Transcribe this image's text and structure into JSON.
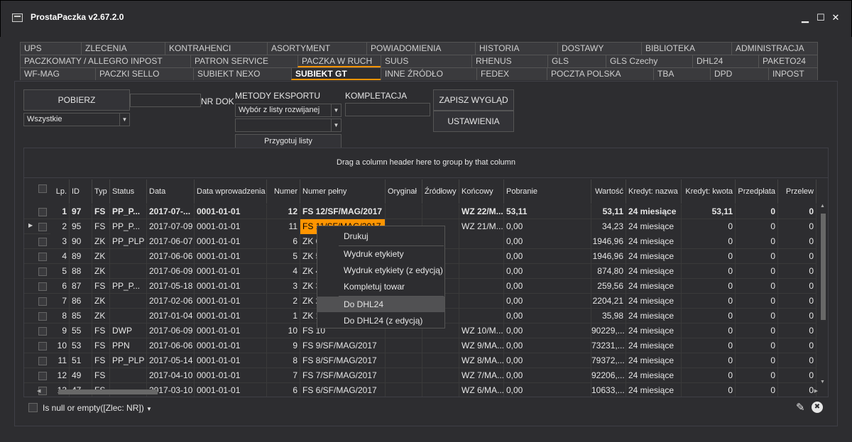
{
  "window": {
    "title": "ProstaPaczka v2.67.2.0",
    "minimize": "▁",
    "maximize": "☐",
    "close": "✕"
  },
  "tabs": {
    "row1": [
      "UPS",
      "ZLECENIA",
      "KONTRAHENCI",
      "ASORTYMENT",
      "POWIADOMIENIA",
      "HISTORIA",
      "DOSTAWY",
      "BIBLIOTEKA",
      "ADMINISTRACJA"
    ],
    "row2": [
      "PACZKOMATY / ALLEGRO INPOST",
      "PATRON SERVICE",
      "PACZKA W RUCH",
      "SUUS",
      "RHENUS",
      "GLS",
      "GLS Czechy",
      "DHL24",
      "PAKETO24"
    ],
    "row3": [
      "WF-MAG",
      "PACZKI SELLO",
      "SUBIEKT NEXO",
      "SUBIEKT GT",
      "INNE ŹRÓDŁO",
      "FEDEX",
      "POCZTA POLSKA",
      "TBA",
      "DPD",
      "INPOST"
    ]
  },
  "toolbar": {
    "pobierz": "POBIERZ",
    "nr_dok_label": "NR DOK",
    "filter_value": "Wszystkie",
    "metody_label": "METODY EKSPORTU",
    "metody_value": "Wybór z listy rozwijanej",
    "przygotuj": "Przygotuj listy",
    "kompletacja_label": "KOMPLETACJA",
    "zapisz": "ZAPISZ WYGLĄD",
    "ustawienia": "USTAWIENIA"
  },
  "grid": {
    "group_hint": "Drag a column header here to group by that column",
    "columns": [
      "Lp.",
      "ID",
      "Typ",
      "Status",
      "Data",
      "Data wprowadzenia",
      "Numer",
      "Numer pełny",
      "Oryginał",
      "Źródłowy",
      "Końcowy",
      "Pobranie",
      "Wartość",
      "Kredyt: nazwa",
      "Kredyt: kwota",
      "Przedpłata",
      "Przelew"
    ],
    "rows": [
      [
        "1",
        "97",
        "FS",
        "PP_P...",
        "2017-07-...",
        "0001-01-01",
        "12",
        "FS 12/SF/MAG/2017",
        "",
        "",
        "WZ 22/M...",
        "53,11",
        "53,11",
        "24 miesiące",
        "53,11",
        "0",
        "0"
      ],
      [
        "2",
        "95",
        "FS",
        "PP_P...",
        "2017-07-09",
        "0001-01-01",
        "11",
        "FS 11/SF/MAG/2017",
        "",
        "",
        "WZ 21/M...",
        "0,00",
        "34,23",
        "24 miesiące",
        "0",
        "0",
        "0"
      ],
      [
        "3",
        "90",
        "ZK",
        "PP_PLP",
        "2017-06-07",
        "0001-01-01",
        "6",
        "ZK 6",
        "",
        "",
        "",
        "0,00",
        "1946,96",
        "24 miesiące",
        "0",
        "0",
        "0"
      ],
      [
        "4",
        "89",
        "ZK",
        "",
        "2017-06-06",
        "0001-01-01",
        "5",
        "ZK 5",
        "",
        "",
        "",
        "0,00",
        "1946,96",
        "24 miesiące",
        "0",
        "0",
        "0"
      ],
      [
        "5",
        "88",
        "ZK",
        "",
        "2017-06-09",
        "0001-01-01",
        "4",
        "ZK 4",
        "",
        "",
        "",
        "0,00",
        "874,80",
        "24 miesiące",
        "0",
        "0",
        "0"
      ],
      [
        "6",
        "87",
        "FS",
        "PP_P...",
        "2017-05-18",
        "0001-01-01",
        "3",
        "ZK 3",
        "",
        "",
        "",
        "0,00",
        "259,56",
        "24 miesiące",
        "0",
        "0",
        "0"
      ],
      [
        "7",
        "86",
        "ZK",
        "",
        "2017-02-06",
        "0001-01-01",
        "2",
        "ZK 2",
        "",
        "",
        "",
        "0,00",
        "2204,21",
        "24 miesiące",
        "0",
        "0",
        "0"
      ],
      [
        "8",
        "85",
        "ZK",
        "",
        "2017-01-04",
        "0001-01-01",
        "1",
        "ZK 1",
        "",
        "",
        "",
        "0,00",
        "35,98",
        "24 miesiące",
        "0",
        "0",
        "0"
      ],
      [
        "9",
        "55",
        "FS",
        "DWP",
        "2017-06-09",
        "0001-01-01",
        "10",
        "FS 10",
        "",
        "",
        "WZ 10/M...",
        "0,00",
        "90229,...",
        "24 miesiące",
        "0",
        "0",
        "0"
      ],
      [
        "10",
        "53",
        "FS",
        "PPN",
        "2017-06-06",
        "0001-01-01",
        "9",
        "FS 9/SF/MAG/2017",
        "",
        "",
        "WZ 9/MA...",
        "0,00",
        "73231,...",
        "24 miesiące",
        "0",
        "0",
        "0"
      ],
      [
        "11",
        "51",
        "FS",
        "PP_PLP",
        "2017-05-14",
        "0001-01-01",
        "8",
        "FS 8/SF/MAG/2017",
        "",
        "",
        "WZ 8/MA...",
        "0,00",
        "79372,...",
        "24 miesiące",
        "0",
        "0",
        "0"
      ],
      [
        "12",
        "49",
        "FS",
        "",
        "2017-04-10",
        "0001-01-01",
        "7",
        "FS 7/SF/MAG/2017",
        "",
        "",
        "WZ 7/MA...",
        "0,00",
        "92206,...",
        "24 miesiące",
        "0",
        "0",
        "0"
      ],
      [
        "13",
        "47",
        "FS",
        "",
        "2017-03-10",
        "0001-01-01",
        "6",
        "FS 6/SF/MAG/2017",
        "",
        "",
        "WZ 6/MA...",
        "0,00",
        "10633,...",
        "24 miesiące",
        "0",
        "0",
        "0"
      ]
    ]
  },
  "context_menu": [
    "Drukuj",
    "Wydruk etykiety",
    "Wydruk etykiety (z edycją)",
    "Kompletuj towar",
    "Do DHL24",
    "Do DHL24 (z edycją)"
  ],
  "filter": {
    "text": "Is null or empty([Zlec: NR])",
    "edit_icon": "✎",
    "clear_icon": "✖"
  },
  "colors": {
    "accent": "#ff9500",
    "background": "#2d2d30",
    "menu_hover": "#515153"
  }
}
